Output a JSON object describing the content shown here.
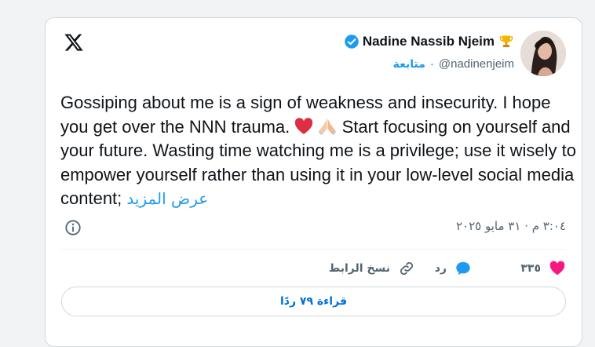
{
  "author": {
    "display_name": "Nadine Nassib Njeim",
    "handle": "@nadinenjeim",
    "follow_label": "متابعة",
    "separator": "·",
    "verified_color": "#1d9bf0",
    "avatar_icon": "profile-photo"
  },
  "logo": {
    "icon": "x-logo-icon"
  },
  "tweet": {
    "text_part1": "Gossiping about me is a sign of weakness and insecurity. I hope you get over the NNN trauma. ",
    "text_part2": " Start focusing on yourself and your future. Wasting time watching me is a privilege; use it wisely to empower yourself rather than using it in your low-level social media content; ",
    "emojis": [
      "red-heart",
      "folded-hands"
    ],
    "read_more": "عرض المزيد"
  },
  "meta": {
    "timestamp": "٣:٠٤ م · ٣١ مايو ٢٠٢٥"
  },
  "actions": {
    "like_count": "٣٣٥",
    "reply_label": "رد",
    "copy_link_label": "نسخ الرابط",
    "like_color": "#f91880",
    "reply_color": "#1d9bf0"
  },
  "replies_button": {
    "label": "قراءة ٧٩ ردًا"
  }
}
